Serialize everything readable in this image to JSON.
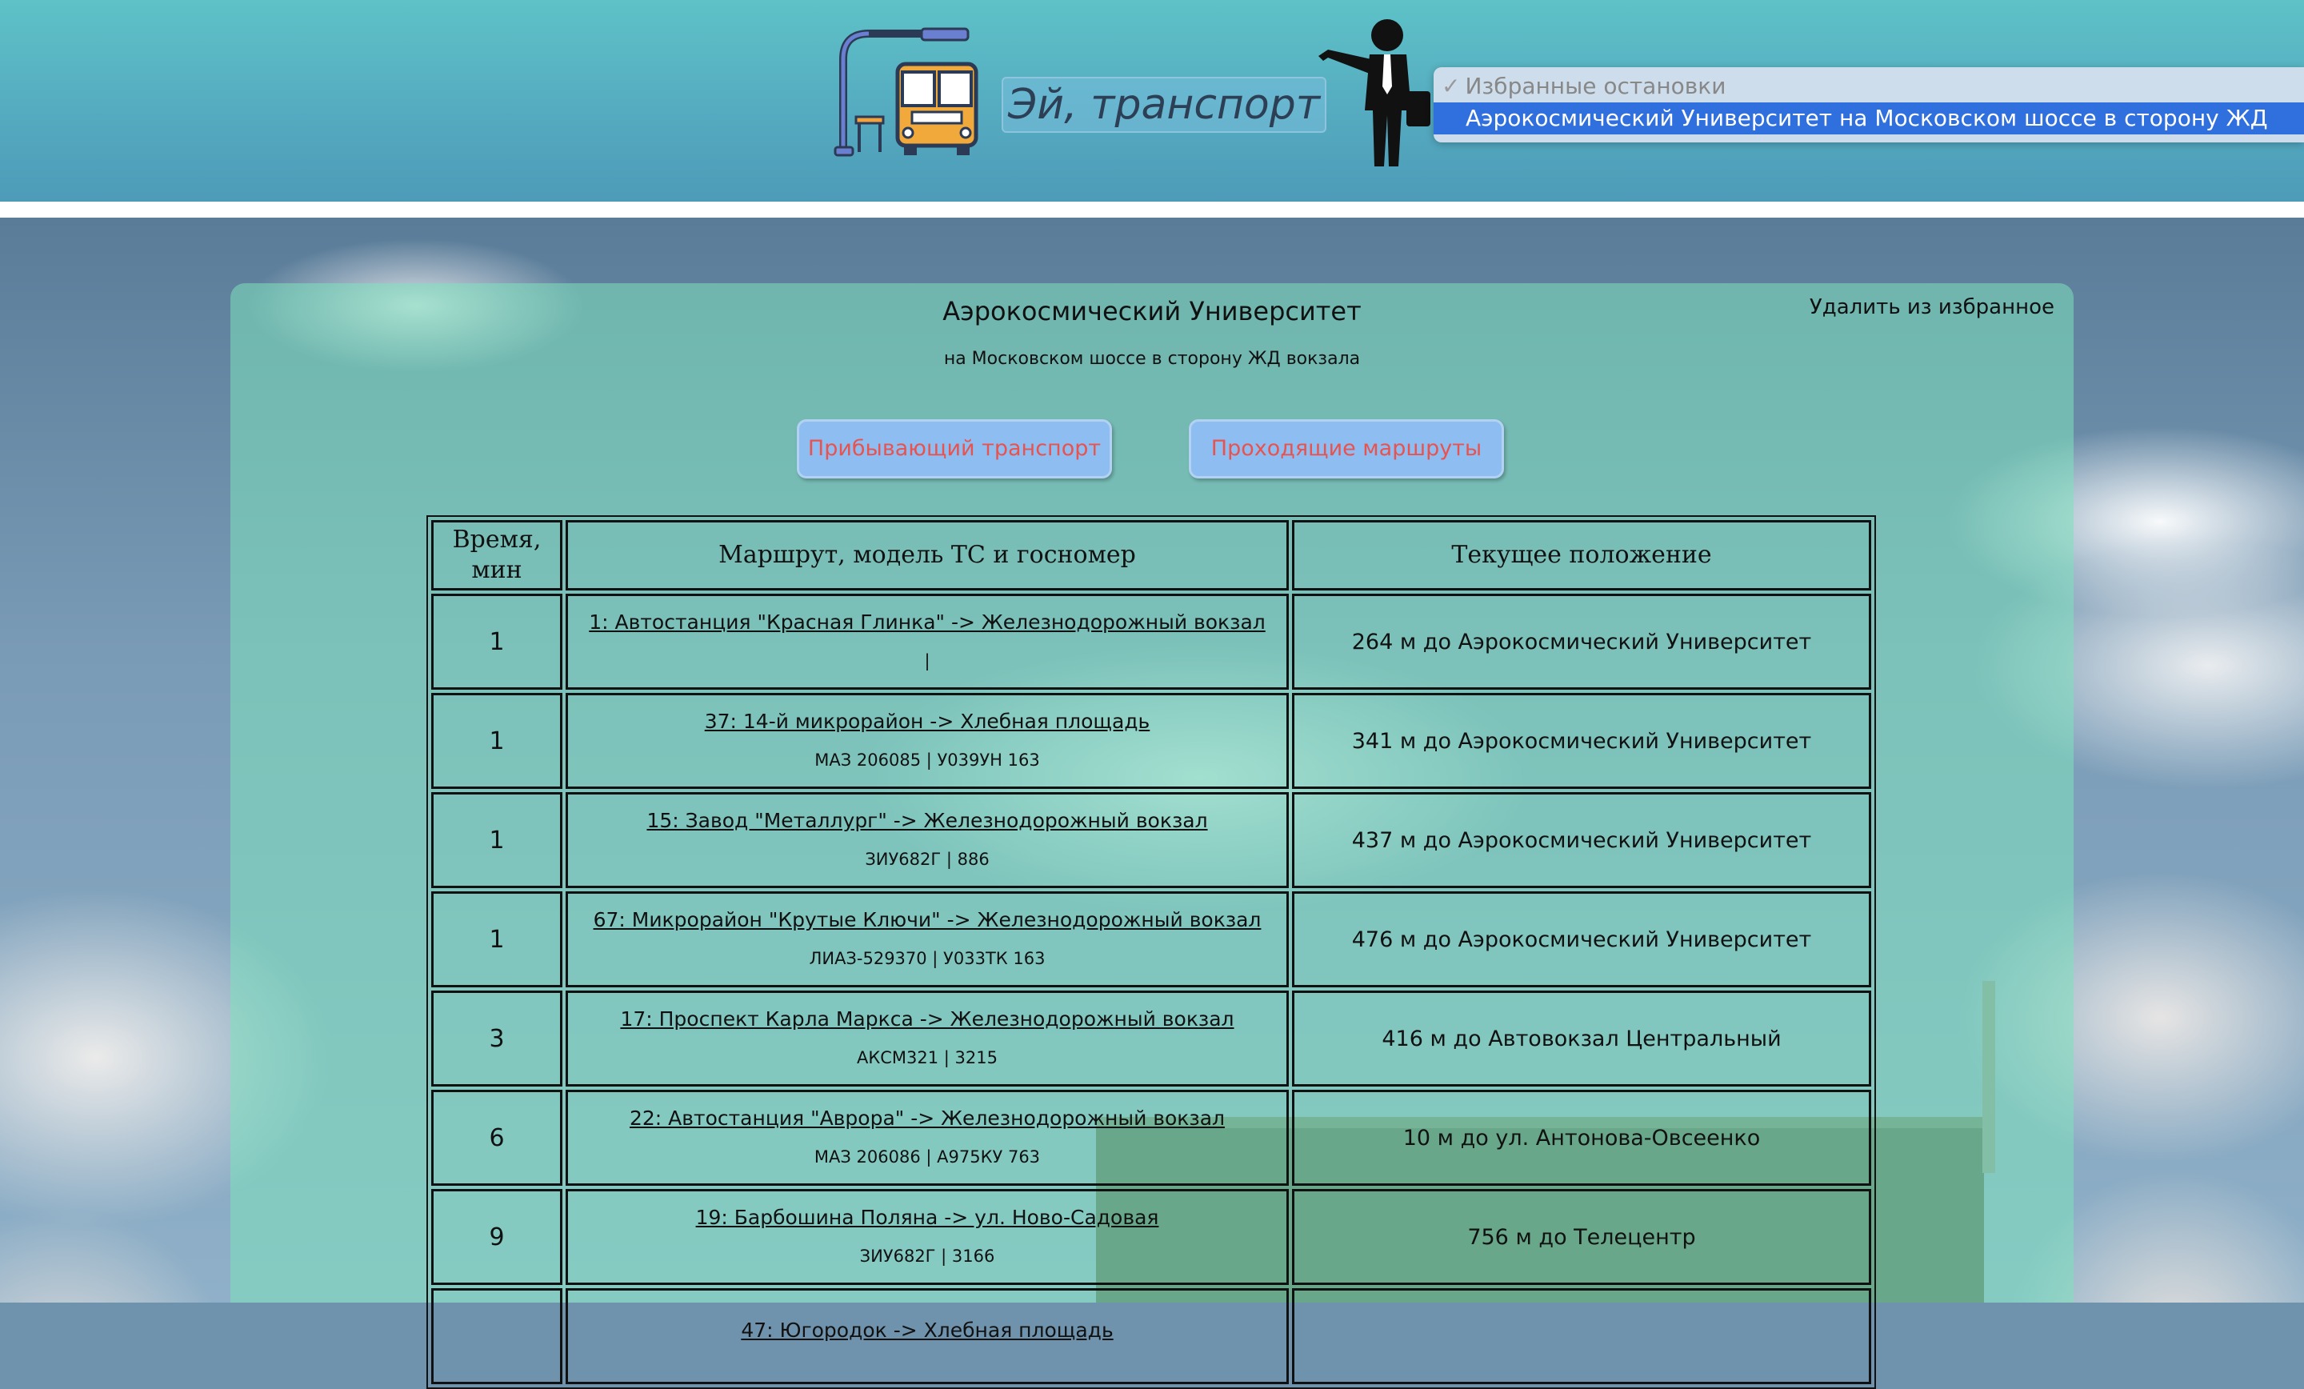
{
  "header": {
    "title": "Эй, транспорт",
    "favorites": {
      "placeholder": "Избранные остановки",
      "check_mark": "✓",
      "options": [
        "Аэрокосмический Университет на Московском шоссе в сторону ЖД вокзала"
      ]
    },
    "icons": {
      "logo": "bus-stop-icon",
      "user": "businessman-icon"
    }
  },
  "stop": {
    "name": "Аэрокосмический Университет",
    "description": "на Московском шоссе в сторону ЖД вокзала",
    "remove_favorite": "Удалить из избранное"
  },
  "tabs": {
    "arrivals": "Прибывающий транспорт",
    "routes": "Проходящие маршруты"
  },
  "table": {
    "headers": [
      "Время, мин",
      "Маршрут, модель ТС и госномер",
      "Текущее положение"
    ],
    "rows": [
      {
        "time": "1",
        "route": "1: Автостанция \"Красная Глинка\" -> Железнодорожный вокзал",
        "vehicle": "|",
        "position": "264 м до Аэрокосмический Университет"
      },
      {
        "time": "1",
        "route": "37: 14-й микрорайон -> Хлебная площадь",
        "vehicle": "МАЗ 206085 | У039УН 163",
        "position": "341 м до Аэрокосмический Университет"
      },
      {
        "time": "1",
        "route": "15: Завод \"Металлург\" -> Железнодорожный вокзал",
        "vehicle": "ЗИУ682Г | 886",
        "position": "437 м до Аэрокосмический Университет"
      },
      {
        "time": "1",
        "route": "67: Микрорайон \"Крутые Ключи\" -> Железнодорожный вокзал",
        "vehicle": "ЛИАЗ-529370 | У033ТК 163",
        "position": "476 м до Аэрокосмический Университет"
      },
      {
        "time": "3",
        "route": "17: Проспект Карла Маркса -> Железнодорожный вокзал",
        "vehicle": "АКСМ321 | 3215",
        "position": "416 м до Автовокзал Центральный"
      },
      {
        "time": "6",
        "route": "22: Автостанция \"Аврора\" -> Железнодорожный вокзал",
        "vehicle": "МАЗ 206086 | А975КУ 763",
        "position": "10 м до ул. Антонова-Овсеенко"
      },
      {
        "time": "9",
        "route": "19: Барбошина Поляна -> ул. Ново-Садовая",
        "vehicle": "ЗИУ682Г | 3166",
        "position": "756 м до Телецентр"
      },
      {
        "time": "",
        "route": "47: Югородок -> Хлебная площадь",
        "vehicle": "",
        "position": ""
      }
    ]
  },
  "colors": {
    "header_bg": "#55abc0",
    "panel_bg": "#7de1be",
    "button_bg": "#8ebdf2",
    "button_text": "#e8534f",
    "selection": "#2f6fde"
  }
}
